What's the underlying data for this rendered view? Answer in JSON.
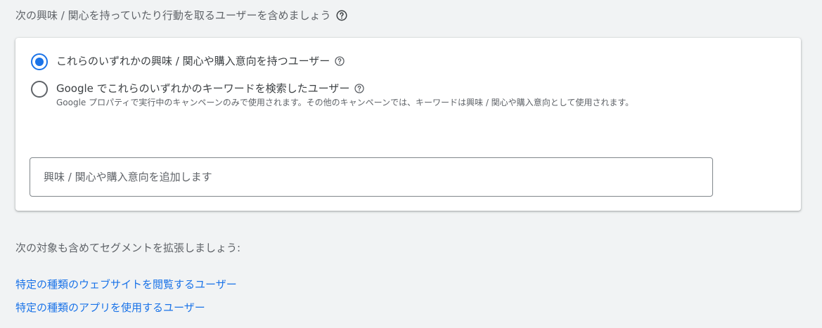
{
  "heading": {
    "label": "次の興味 / 関心を持っていたり行動を取るユーザーを含めましょう",
    "icon": "help-circle-icon"
  },
  "options": [
    {
      "label": "これらのいずれかの興味 / 関心や購入意向を持つユーザー",
      "selected": true,
      "description": ""
    },
    {
      "label": "Google でこれらのいずれかのキーワードを検索したユーザー",
      "selected": false,
      "description": "Google プロパティで実行中のキャンペーンのみで使用されます。その他のキャンペーンでは、キーワードは興味 / 関心や購入意向として使用されます。"
    }
  ],
  "input": {
    "placeholder": "興味 / 関心や購入意向を追加します",
    "value": ""
  },
  "extend": {
    "heading": "次の対象も含めてセグメントを拡張しましょう:",
    "links": [
      "特定の種類のウェブサイトを閲覧するユーザー",
      "特定の種類のアプリを使用するユーザー"
    ]
  },
  "colors": {
    "accent": "#1a73e8",
    "background": "#f1f3f4",
    "card": "#ffffff",
    "text": "#3c4043",
    "secondary_text": "#5f6368"
  }
}
